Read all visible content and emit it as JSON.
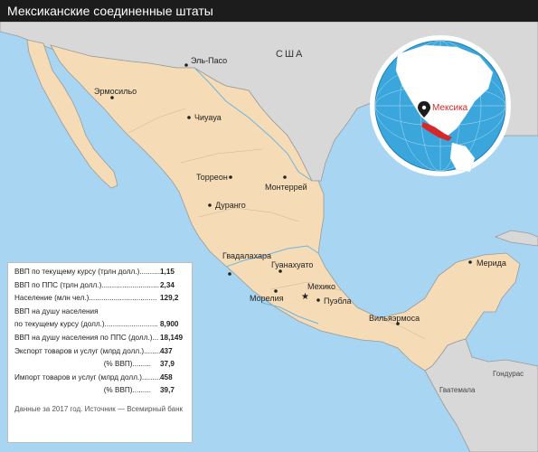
{
  "title": "Мексиканские соединенные штаты",
  "colors": {
    "ocean": "#a8d5f2",
    "land_mexico": "#f5dcb7",
    "land_other": "#d8d8d8",
    "border": "#9a9a9a",
    "river": "#6fb4de",
    "highlight": "#d62828"
  },
  "countries": {
    "usa": "США",
    "guatemala": "Гватемала",
    "honduras": "Гондурас"
  },
  "globe_label": "Мексика",
  "cities": [
    {
      "id": "el-paso",
      "name": "Эль-Пасо"
    },
    {
      "id": "hermosillo",
      "name": "Эрмосильо"
    },
    {
      "id": "chihuahua",
      "name": "Чиуауа"
    },
    {
      "id": "torreon",
      "name": "Торреон"
    },
    {
      "id": "monterrey",
      "name": "Монтеррей"
    },
    {
      "id": "durango",
      "name": "Дуранго"
    },
    {
      "id": "guadalajara",
      "name": "Гвадалахара"
    },
    {
      "id": "guanajuato",
      "name": "Гуанахуато"
    },
    {
      "id": "mexico",
      "name": "Мехико"
    },
    {
      "id": "morelia",
      "name": "Морелия"
    },
    {
      "id": "puebla",
      "name": "Пуэбла"
    },
    {
      "id": "villahermosa",
      "name": "Вильяэрмоса"
    },
    {
      "id": "merida",
      "name": "Мерида"
    }
  ],
  "stats": [
    {
      "label": "ВВП по текущему курсу (трлн долл.)..........",
      "value": "1,15"
    },
    {
      "label": "ВВП по ППС (трлн долл.)............................",
      "value": "2,34"
    },
    {
      "label": "Население (млн чел.).................................",
      "value": "129,2"
    },
    {
      "label": "ВВП на душу населения",
      "value": ""
    },
    {
      "label": "по текущему курсу (долл.)..........................",
      "value": "8,900"
    },
    {
      "label": "ВВП на душу населения по ППС (долл.)...",
      "value": "18,149"
    },
    {
      "label": "Экспорт товаров и услуг (млрд долл.).........",
      "value": "437"
    },
    {
      "label": "(% ВВП).........",
      "value": "37,9"
    },
    {
      "label": "Импорт товаров и услуг (млрд долл.).........",
      "value": "458"
    },
    {
      "label": "(% ВВП).........",
      "value": "39,7"
    }
  ],
  "source": "Данные за 2017 год. Источник — Всемирный банк"
}
